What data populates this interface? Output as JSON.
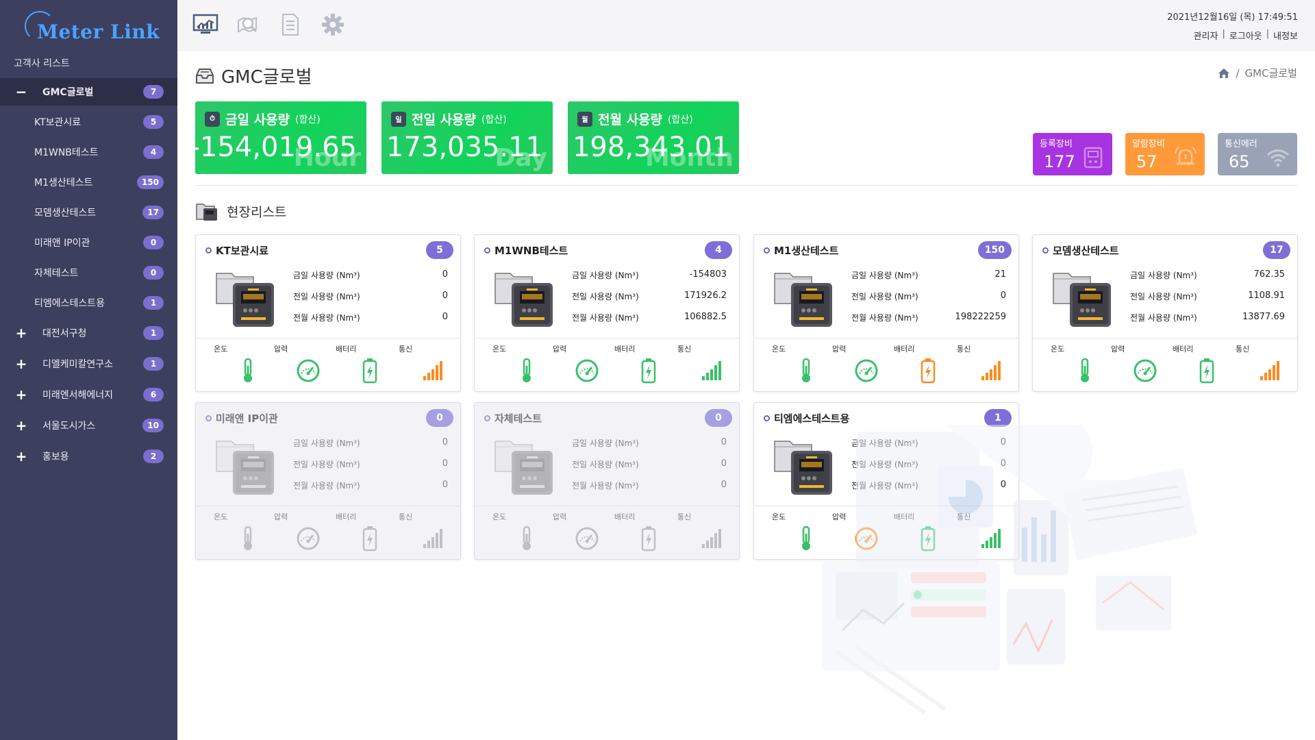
{
  "sidebar": {
    "logo": "Meter Link",
    "client_list_title": "고객사 리스트",
    "items": [
      {
        "toggle": "−",
        "label": "GMC글로벌",
        "count": "7",
        "kind": "top"
      },
      {
        "toggle": "",
        "label": "KT보관시료",
        "count": "5",
        "kind": "sub"
      },
      {
        "toggle": "",
        "label": "M1WNB테스트",
        "count": "4",
        "kind": "sub"
      },
      {
        "toggle": "",
        "label": "M1생산테스트",
        "count": "150",
        "kind": "sub"
      },
      {
        "toggle": "",
        "label": "모뎀생산테스트",
        "count": "17",
        "kind": "sub"
      },
      {
        "toggle": "",
        "label": "미래앤 IP이관",
        "count": "0",
        "kind": "sub"
      },
      {
        "toggle": "",
        "label": "자체테스트",
        "count": "0",
        "kind": "sub"
      },
      {
        "toggle": "",
        "label": "티엠에스테스트용",
        "count": "1",
        "kind": "sub"
      },
      {
        "toggle": "+",
        "label": "대전서구청",
        "count": "1",
        "kind": "group"
      },
      {
        "toggle": "+",
        "label": "디엘케미칼연구소",
        "count": "1",
        "kind": "group"
      },
      {
        "toggle": "+",
        "label": "미래엔서해에너지",
        "count": "6",
        "kind": "group"
      },
      {
        "toggle": "+",
        "label": "서울도시가스",
        "count": "10",
        "kind": "group"
      },
      {
        "toggle": "+",
        "label": "홍보용",
        "count": "2",
        "kind": "group"
      }
    ]
  },
  "topbar": {
    "icons": [
      "monitor-chart-icon",
      "search-map-icon",
      "document-icon",
      "gear-icon"
    ],
    "datetime": "2021년12월16일 (목) 17:49:51",
    "links": [
      "관리자",
      "로그아웃",
      "내정보"
    ]
  },
  "page": {
    "title": "GMC글로벌",
    "breadcrumb": "GMC글로벌"
  },
  "summary": [
    {
      "label": "금일 사용량",
      "suffix": "(합산)",
      "value": "-154,019.65",
      "ghost": "Hour",
      "icon_text": "⏱"
    },
    {
      "label": "전일 사용량",
      "suffix": "(합산)",
      "value": "173,035.11",
      "ghost": "Day",
      "icon_text": "일"
    },
    {
      "label": "전월 사용량",
      "suffix": "(합산)",
      "value": "198,343.01",
      "ghost": "Month",
      "icon_text": "월"
    }
  ],
  "stats": [
    {
      "label": "등록장비",
      "value": "177",
      "color": "#a833e0"
    },
    {
      "label": "알람장비",
      "value": "57",
      "color": "#ff9a3a"
    },
    {
      "label": "통신에러",
      "value": "65",
      "color": "#9aa3b5"
    }
  ],
  "site_list_title": "현장리스트",
  "row_labels": [
    "금일 사용량 (Nm³)",
    "전일 사용량 (Nm³)",
    "전월 사용량 (Nm³)"
  ],
  "stat_labels": [
    "온도",
    "압력",
    "배터리",
    "통신"
  ],
  "sites": [
    {
      "name": "KT보관시료",
      "count": "5",
      "values": [
        "0",
        "0",
        "0"
      ]
    },
    {
      "name": "M1WNB테스트",
      "count": "4",
      "values": [
        "-154803",
        "171926.2",
        "106882.5"
      ]
    },
    {
      "name": "M1생산테스트",
      "count": "150",
      "values": [
        "21",
        "0",
        "198222259"
      ]
    },
    {
      "name": "모뎀생산테스트",
      "count": "17",
      "values": [
        "762.35",
        "1108.91",
        "13877.69"
      ]
    },
    {
      "name": "미래앤 IP이관",
      "count": "0",
      "values": [
        "0",
        "0",
        "0"
      ]
    },
    {
      "name": "자체테스트",
      "count": "0",
      "values": [
        "0",
        "0",
        "0"
      ]
    },
    {
      "name": "티엠에스테스트용",
      "count": "1",
      "values": [
        "0",
        "0",
        "0"
      ]
    }
  ],
  "colors": {
    "sidebar_bg": "#3d3f5e",
    "badge": "#7d6fd6",
    "green": "#2ec76a",
    "orange": "#ff8a1f"
  }
}
